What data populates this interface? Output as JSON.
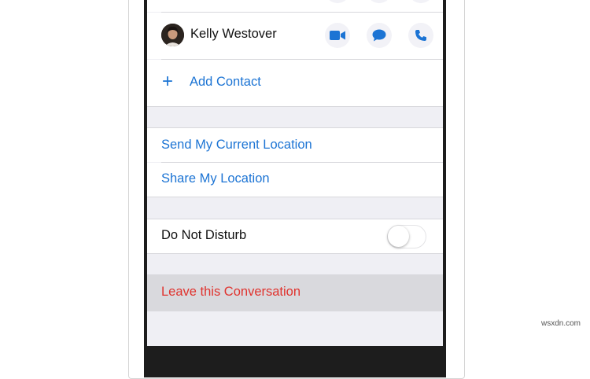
{
  "contact": {
    "name": "Kelly Westover",
    "actions": [
      "video-call",
      "message",
      "phone-call"
    ]
  },
  "add_contact": {
    "icon": "+",
    "label": "Add Contact"
  },
  "location": {
    "send_current": "Send My Current Location",
    "share": "Share My Location"
  },
  "dnd": {
    "label": "Do Not Disturb",
    "enabled": false
  },
  "leave": {
    "label": "Leave this Conversation"
  },
  "watermark": "wsxdn.com",
  "colors": {
    "accent": "#1c74d4",
    "destructive": "#e0332e",
    "background": "#efeff4"
  }
}
